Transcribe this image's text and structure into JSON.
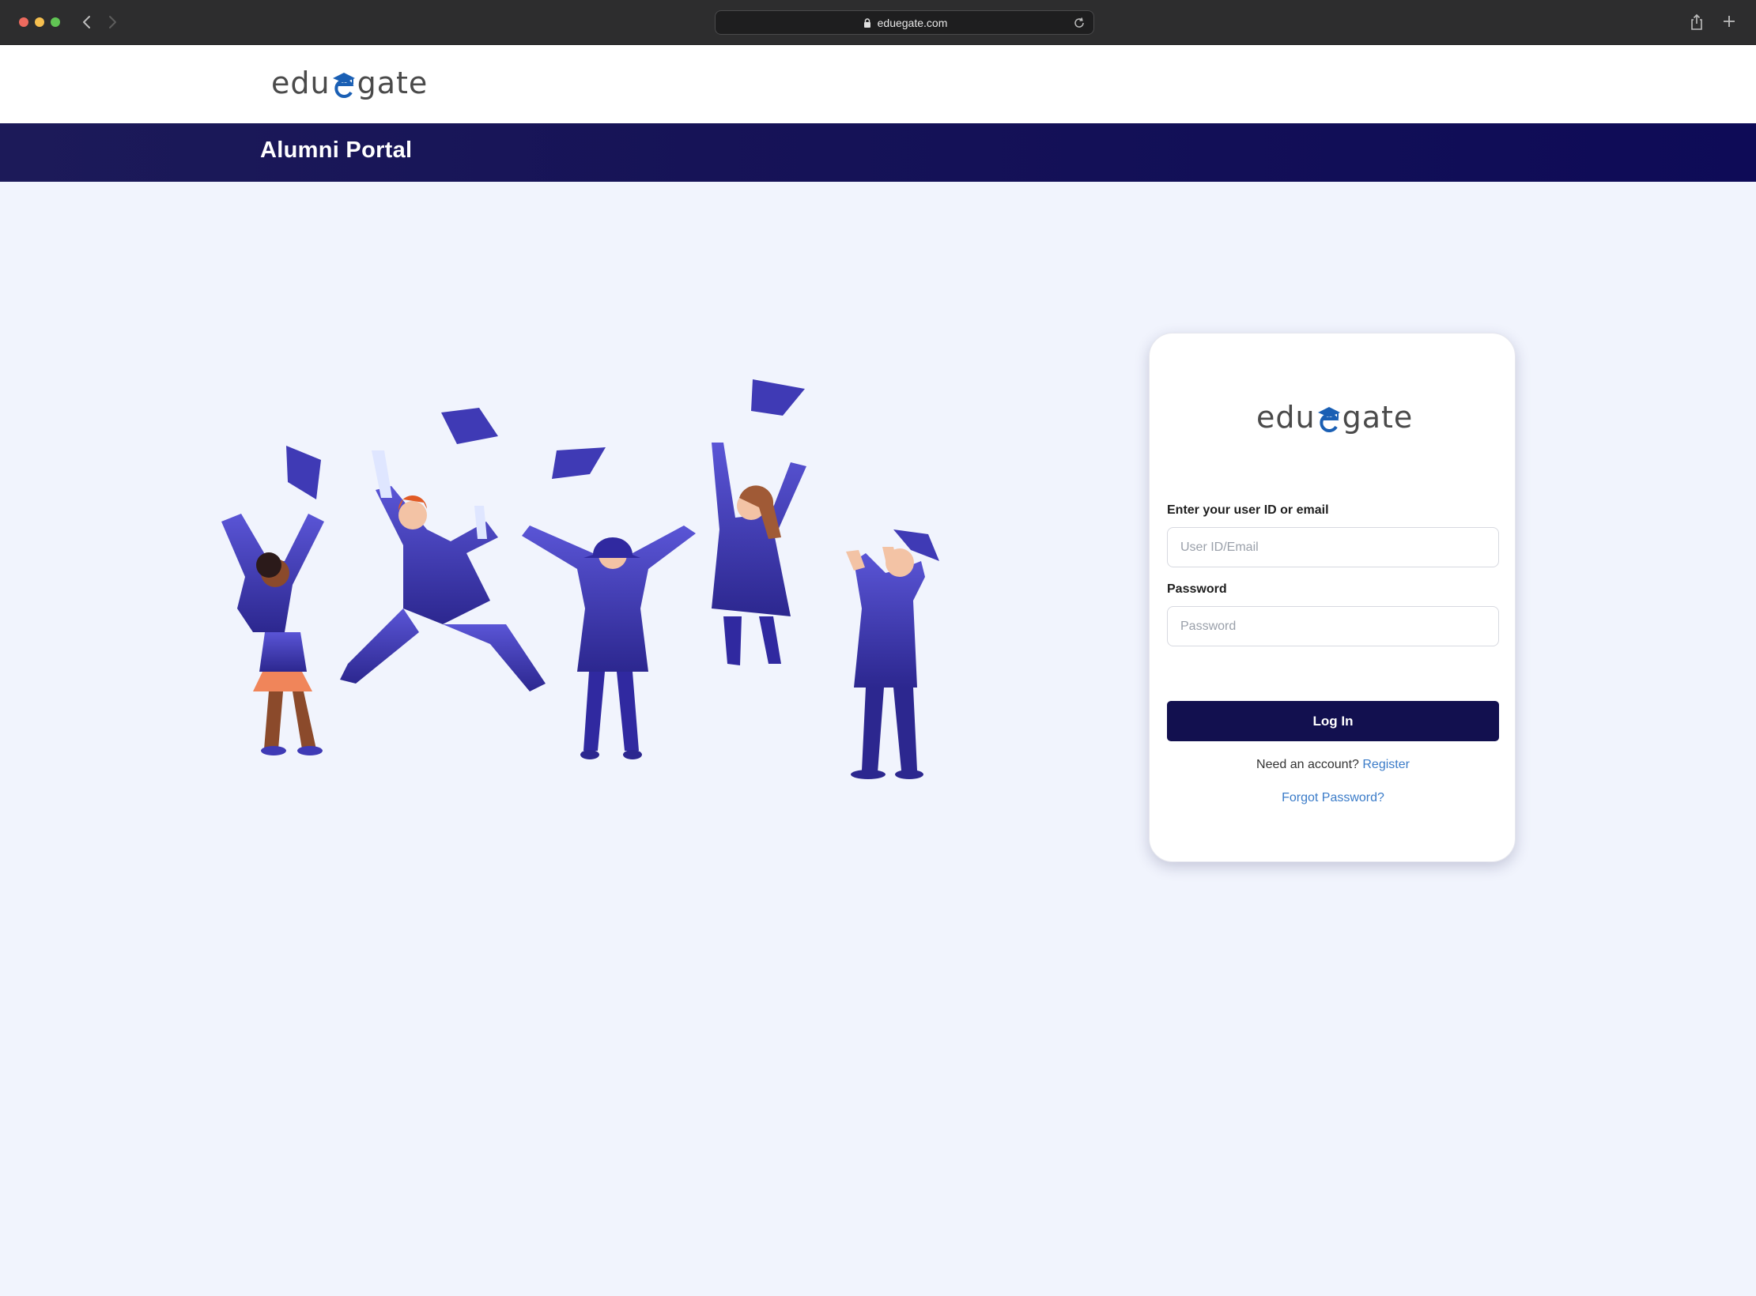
{
  "browser": {
    "url": "eduegate.com"
  },
  "header": {
    "logo_prefix": "edu",
    "logo_suffix": "gate",
    "banner_title": "Alumni Portal"
  },
  "login": {
    "logo_prefix": "edu",
    "logo_suffix": "gate",
    "user_label": "Enter your user ID or email",
    "user_placeholder": "User ID/Email",
    "password_label": "Password",
    "password_placeholder": "Password",
    "login_button": "Log In",
    "register_prompt": "Need an account?",
    "register_link": "Register",
    "forgot_link": "Forgot Password?"
  },
  "colors": {
    "banner": "#161357",
    "button": "#12104f",
    "link": "#3a7bc8",
    "page_bg": "#f1f4fd",
    "logo_mark": "#1a5fb4"
  },
  "icons": {
    "logo_mark": "graduation-cap-e-icon"
  }
}
